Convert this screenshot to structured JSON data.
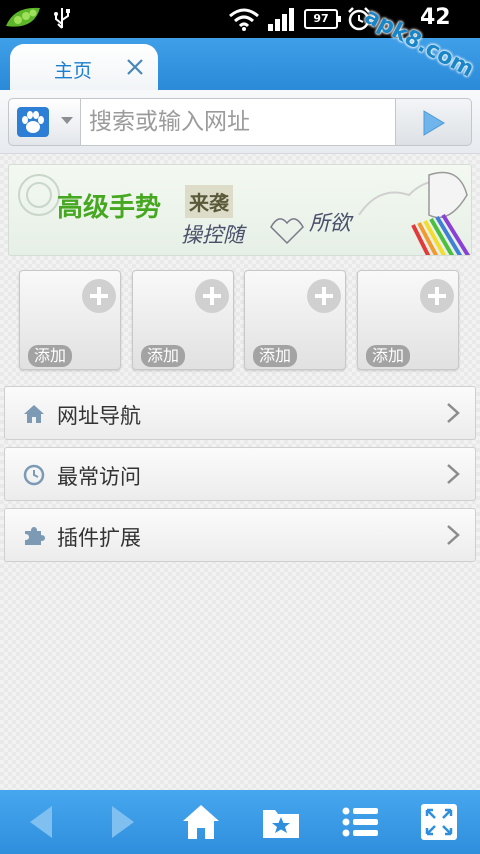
{
  "status_bar": {
    "battery_level": "97",
    "time": "42",
    "watermark": "apk8.com"
  },
  "tab": {
    "label": "主页"
  },
  "search": {
    "placeholder": "搜索或输入网址",
    "engine_icon": "baidu-paw-icon"
  },
  "banner": {
    "title": "高级手势",
    "stamp": "来袭",
    "sub_left": "操控随",
    "sub_right": "所欲"
  },
  "quick_tiles": [
    {
      "label": "添加"
    },
    {
      "label": "添加"
    },
    {
      "label": "添加"
    },
    {
      "label": "添加"
    }
  ],
  "menu": [
    {
      "label": "网址导航",
      "icon": "home-icon"
    },
    {
      "label": "最常访问",
      "icon": "clock-icon"
    },
    {
      "label": "插件扩展",
      "icon": "puzzle-icon"
    }
  ],
  "toolbar": {
    "buttons": [
      "back-icon",
      "forward-icon",
      "home-icon",
      "bookmark-star-icon",
      "menu-list-icon",
      "fullscreen-icon"
    ]
  },
  "colors": {
    "accent": "#2b8ad8",
    "tab_text": "#1a7fcf",
    "banner_green": "#46a821"
  }
}
